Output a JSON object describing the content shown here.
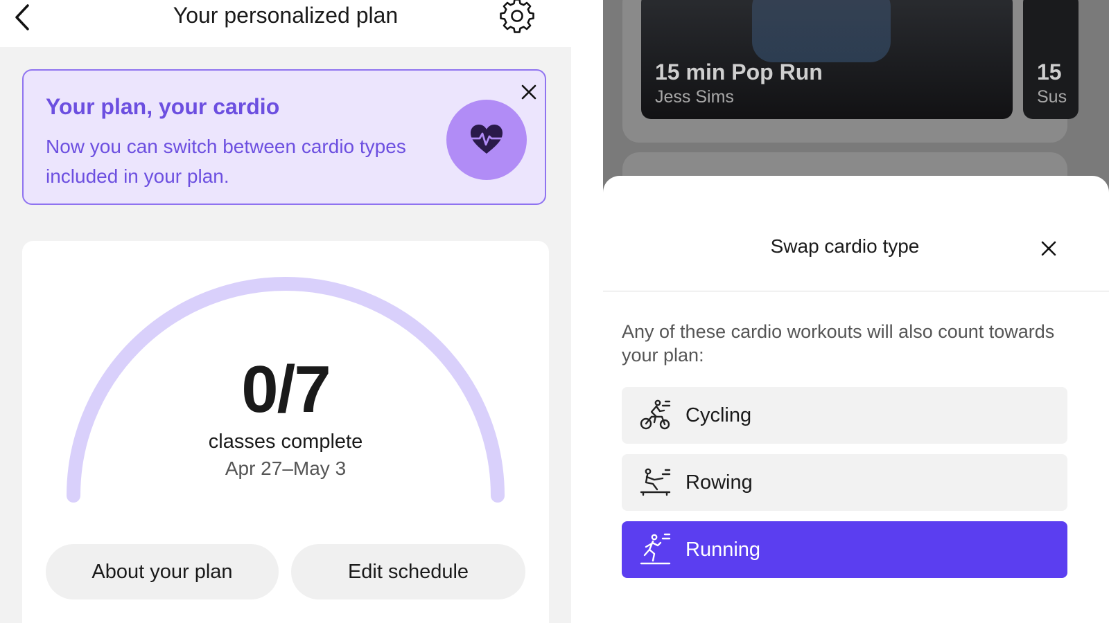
{
  "left": {
    "header": {
      "title": "Your personalized plan",
      "back_icon": "chevron-left-icon",
      "settings_icon": "gear-icon"
    },
    "banner": {
      "title": "Your plan, your cardio",
      "body": "Now you can switch between cardio types included in your plan.",
      "close_icon": "close-icon",
      "badge_icon": "heart-pulse-icon"
    },
    "progress": {
      "count": "0/7",
      "completed": 0,
      "total": 7,
      "label": "classes complete",
      "date_range": "Apr 27–May 3"
    },
    "buttons": {
      "about": "About your plan",
      "edit": "Edit schedule"
    }
  },
  "right": {
    "background_card": {
      "title": "15 min Pop Run",
      "instructor": "Jess Sims",
      "peek_title": "15",
      "peek_sub": "Sus"
    },
    "sheet": {
      "title": "Swap cardio type",
      "close_icon": "close-icon",
      "description": "Any of these cardio workouts will also count towards your plan:",
      "options": [
        {
          "label": "Cycling",
          "icon": "cycling-icon",
          "selected": false
        },
        {
          "label": "Rowing",
          "icon": "rowing-icon",
          "selected": false
        },
        {
          "label": "Running",
          "icon": "running-icon",
          "selected": true
        }
      ]
    }
  },
  "colors": {
    "accent": "#5b3ef0",
    "banner_bg": "#ece5fd",
    "banner_text": "#6c4fe0",
    "arc": "#d9d0fb",
    "badge": "#b18cf6"
  }
}
